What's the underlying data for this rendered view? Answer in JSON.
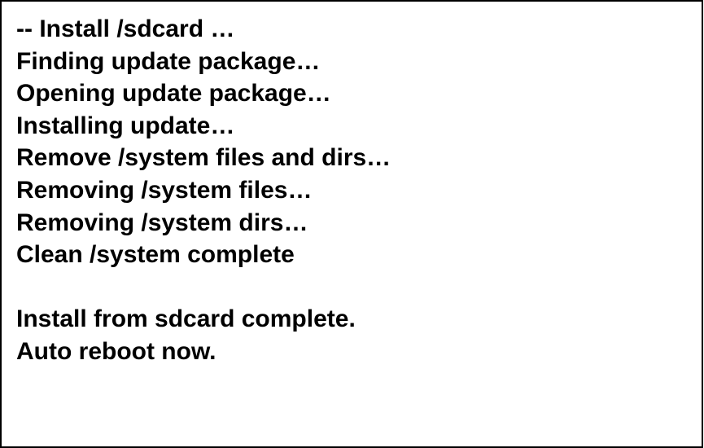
{
  "log": {
    "lines": [
      "-- Install /sdcard …",
      "Finding update package…",
      "Opening update package…",
      "Installing update…",
      "Remove /system files and dirs…",
      "Removing /system files…",
      "Removing /system dirs…",
      "Clean /system complete",
      "",
      "Install from sdcard complete.",
      "Auto reboot now."
    ]
  },
  "colors": {
    "text": "#000000",
    "background": "#ffffff",
    "border": "#000000"
  }
}
